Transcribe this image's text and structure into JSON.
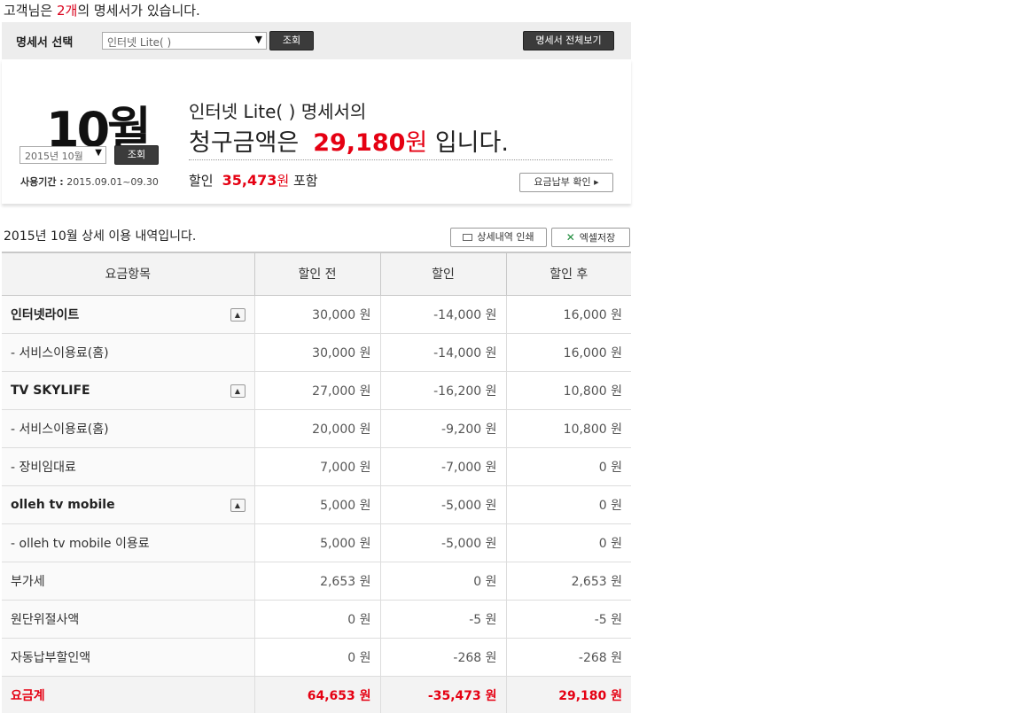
{
  "notice": {
    "prefix": "고객님은 ",
    "count": "2개",
    "suffix": "의 명세서가 있습니다."
  },
  "selector": {
    "label": "명세서 선택",
    "selected": "인터넷 Lite(           )",
    "query_button": "조회",
    "view_all_button": "명세서 전체보기"
  },
  "summary": {
    "month": "10월",
    "month_select": "2015년 10월",
    "query_button": "조회",
    "period_label": "사용기간 :",
    "period_value": "2015.09.01~09.30",
    "line1": "인터넷 Lite(               ) 명세서의",
    "line2_prefix": "청구금액은",
    "amount": "29,180",
    "amount_unit": "원",
    "line2_suffix": " 입니다.",
    "discount_label": "할인",
    "discount_amount": "35,473",
    "discount_unit": "원",
    "discount_suffix": " 포함",
    "pay_button": "요금납부 확인 ▸"
  },
  "detail": {
    "title": "2015년 10월 상세 이용 내역입니다.",
    "print_button": "상세내역 인쇄",
    "excel_button": "엑셀저장"
  },
  "table": {
    "headers": [
      "요금항목",
      "할인 전",
      "할인",
      "할인 후"
    ],
    "rows": [
      {
        "item": "인터넷라이트",
        "before": "30,000 원",
        "discount": "-14,000 원",
        "after": "16,000 원",
        "group": true
      },
      {
        "item": "- 서비스이용료(홈)",
        "before": "30,000 원",
        "discount": "-14,000 원",
        "after": "16,000 원",
        "group": false
      },
      {
        "item": "TV SKYLIFE",
        "before": "27,000 원",
        "discount": "-16,200 원",
        "after": "10,800 원",
        "group": true
      },
      {
        "item": "- 서비스이용료(홈)",
        "before": "20,000 원",
        "discount": "-9,200 원",
        "after": "10,800 원",
        "group": false
      },
      {
        "item": "- 장비임대료",
        "before": "7,000 원",
        "discount": "-7,000 원",
        "after": "0 원",
        "group": false
      },
      {
        "item": "olleh tv mobile",
        "before": "5,000 원",
        "discount": "-5,000 원",
        "after": "0 원",
        "group": true
      },
      {
        "item": "- olleh tv mobile 이용료",
        "before": "5,000 원",
        "discount": "-5,000 원",
        "after": "0 원",
        "group": false
      },
      {
        "item": "부가세",
        "before": "2,653 원",
        "discount": "0 원",
        "after": "2,653 원",
        "group": false
      },
      {
        "item": "원단위절사액",
        "before": "0 원",
        "discount": "-5 원",
        "after": "-5 원",
        "group": false
      },
      {
        "item": "자동납부할인액",
        "before": "0 원",
        "discount": "-268 원",
        "after": "-268 원",
        "group": false
      }
    ],
    "total": {
      "item": "요금계",
      "before": "64,653 원",
      "discount": "-35,473 원",
      "after": "29,180 원"
    }
  },
  "colors": {
    "accent_red": "#e50012",
    "dark_button": "#3b3b3b"
  },
  "icons": {
    "collapse": "chevron-up-icon",
    "print": "printer-icon",
    "excel": "excel-icon"
  }
}
